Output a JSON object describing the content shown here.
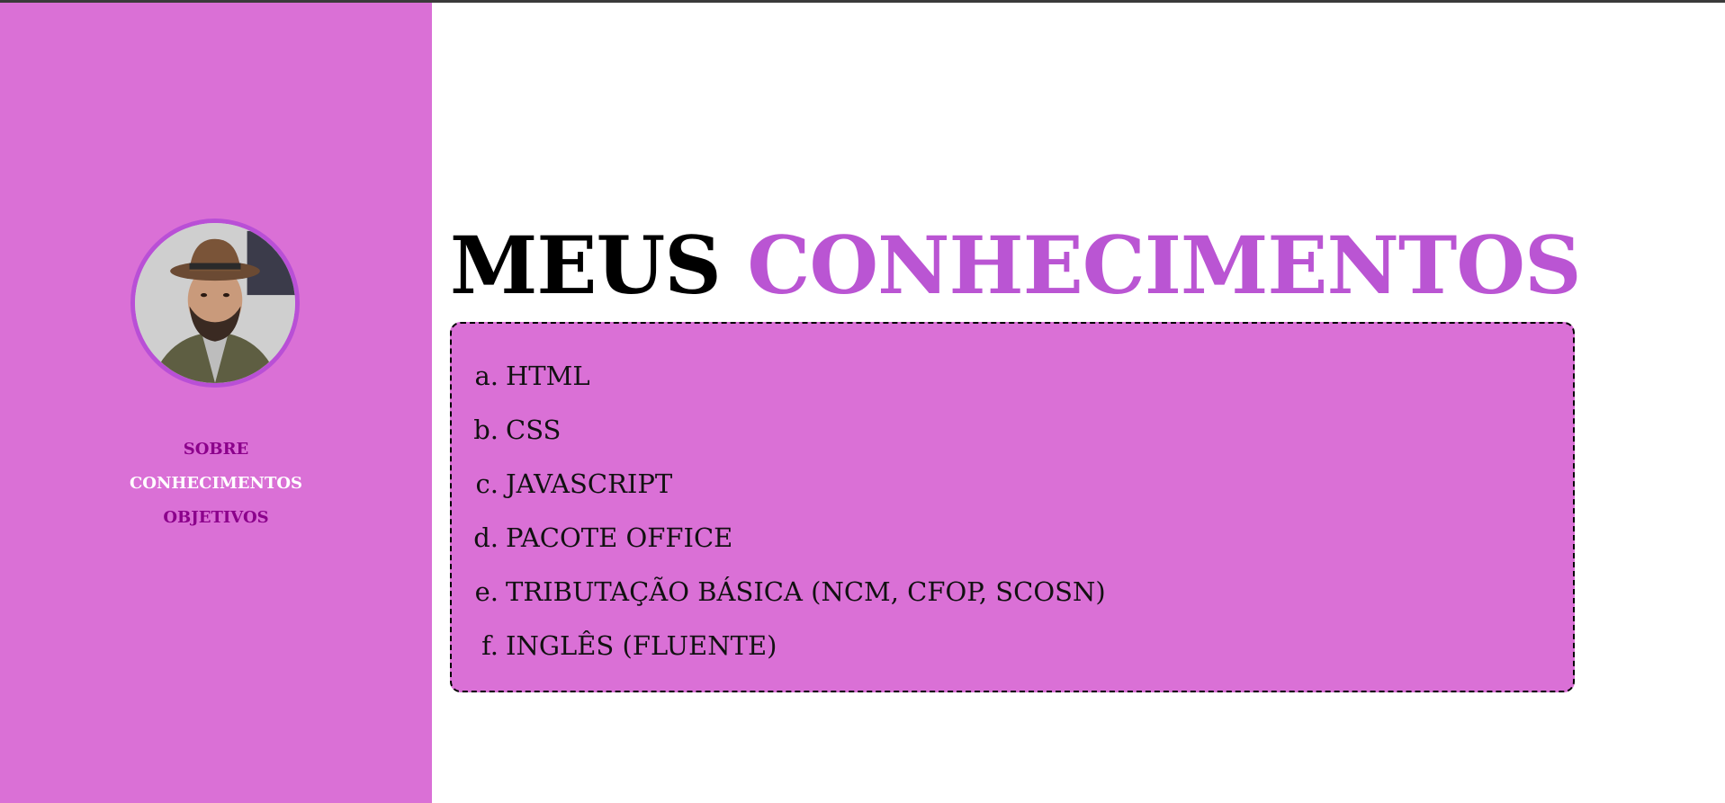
{
  "sidebar": {
    "avatar_label": "profile photo",
    "nav": [
      {
        "label": "SOBRE",
        "active": false
      },
      {
        "label": "CONHECIMENTOS",
        "active": true
      },
      {
        "label": "OBJETIVOS",
        "active": false
      }
    ]
  },
  "main": {
    "title_part1": "MEUS",
    "title_part2": "CONHECIMENTOS",
    "skills": [
      {
        "marker": "a.",
        "label": "HTML"
      },
      {
        "marker": "b.",
        "label": "CSS"
      },
      {
        "marker": "c.",
        "label": "JAVASCRIPT"
      },
      {
        "marker": "d.",
        "label": "PACOTE OFFICE"
      },
      {
        "marker": "e.",
        "label": "TRIBUTAÇÃO BÁSICA (NCM, CFOP, SCOSN)"
      },
      {
        "marker": "f.",
        "label": "INGLÊS (FLUENTE)"
      }
    ]
  },
  "colors": {
    "sidebar_bg": "#da70d6",
    "accent": "#ba55d3",
    "nav_link": "#8b008b",
    "nav_active": "#ffffff"
  }
}
